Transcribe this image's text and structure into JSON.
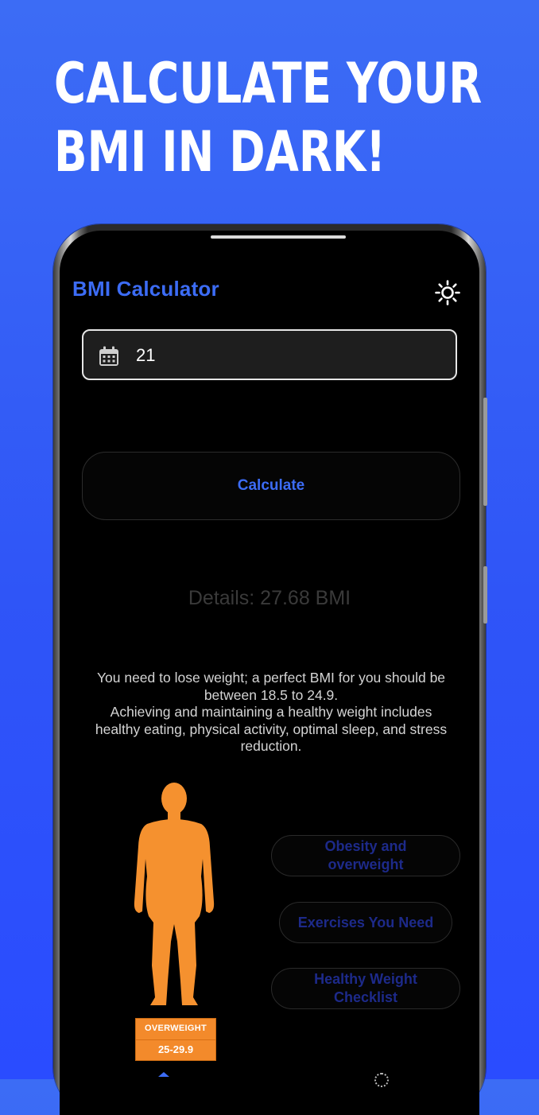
{
  "promo": {
    "headline_line1": "CALCULATE YOUR",
    "headline_line2": "BMI IN DARK!"
  },
  "app": {
    "title": "BMI Calculator",
    "theme_icon": "sun-icon",
    "accent_color": "#3c6cf5"
  },
  "form": {
    "age_icon": "calendar-icon",
    "age_value": "21",
    "calculate_label": "Calculate"
  },
  "result": {
    "details": "Details: 27.68 BMI",
    "advice_line1": "You need to lose weight; a perfect BMI for you should be",
    "advice_line2": "between 18.5 to 24.9.",
    "advice_line3": "Achieving and maintaining a healthy weight includes",
    "advice_line4": "healthy eating, physical activity, optimal sleep, and stress",
    "advice_line5": "reduction.",
    "category_label": "OVERWEIGHT",
    "category_range": "25-29.9",
    "category_color": "#f38a2b"
  },
  "links": {
    "obesity_line1": "Obesity and",
    "obesity_line2": "overweight",
    "exercises": "Exercises You Need",
    "checklist_line1": "Healthy Weight",
    "checklist_line2": "Checklist"
  }
}
